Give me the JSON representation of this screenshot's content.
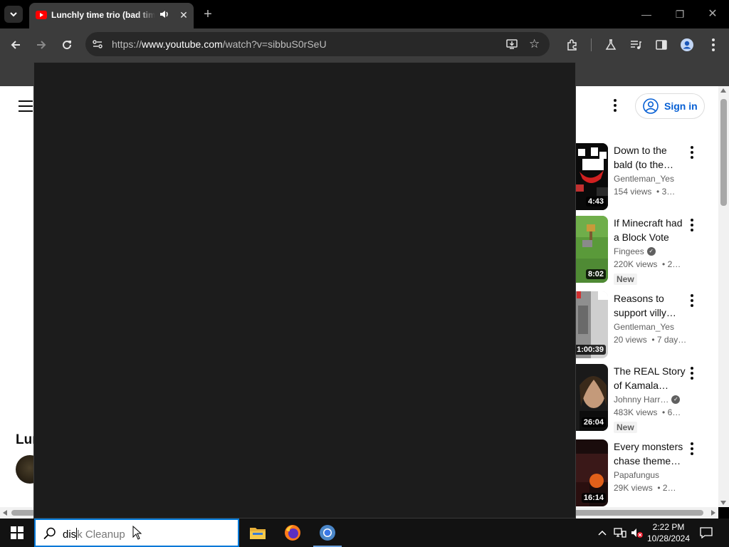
{
  "browser": {
    "tab": {
      "title": "Lunchly time trio (bad time",
      "close": "✕"
    },
    "new_tab": "+",
    "window_controls": {
      "minimize": "—",
      "restore": "❐",
      "close": "✕"
    },
    "url_prefix": "https://",
    "url_host": "www.youtube.com",
    "url_path": "/watch?v=sibbuS0rSeU",
    "icons": [
      "tab-search-icon",
      "youtube-favicon",
      "audio-playing-icon",
      "back-icon",
      "forward-icon",
      "reload-icon",
      "site-info-icon",
      "install-app-icon",
      "bookmark-star-icon",
      "extensions-icon",
      "labs-icon",
      "media-controls-icon",
      "side-panel-icon",
      "profile-icon",
      "chrome-menu-icon"
    ]
  },
  "youtube": {
    "signin_label": "Sign in",
    "video_title_peek": "Lur",
    "recommendations": [
      {
        "title": "Down to the bald (to the…",
        "channel": "Gentleman_Yes",
        "verified": false,
        "views": "154 views",
        "age": "3…",
        "duration": "4:43",
        "badge": ""
      },
      {
        "title": "If Minecraft had a Block Vote",
        "channel": "Fingees",
        "verified": true,
        "views": "220K views",
        "age": "2…",
        "duration": "8:02",
        "badge": "New"
      },
      {
        "title": "Reasons to support villy…",
        "channel": "Gentleman_Yes",
        "verified": false,
        "views": "20 views",
        "age": "7 day…",
        "duration": "1:00:39",
        "badge": ""
      },
      {
        "title": "The REAL Story of Kamala…",
        "channel": "Johnny Harr…",
        "verified": true,
        "views": "483K views",
        "age": "6…",
        "duration": "26:04",
        "badge": "New"
      },
      {
        "title": "Every monsters chase theme…",
        "channel": "Papafungus",
        "verified": false,
        "views": "29K views",
        "age": "2…",
        "duration": "16:14",
        "badge": ""
      }
    ]
  },
  "taskbar": {
    "search_typed": "dis",
    "search_suggestion": "k Cleanup",
    "clock_time": "2:22 PM",
    "clock_date": "10/28/2024"
  },
  "colors": {
    "accent": "#0078d7",
    "youtube_red": "#ff0000",
    "signin_blue": "#065fd4"
  }
}
